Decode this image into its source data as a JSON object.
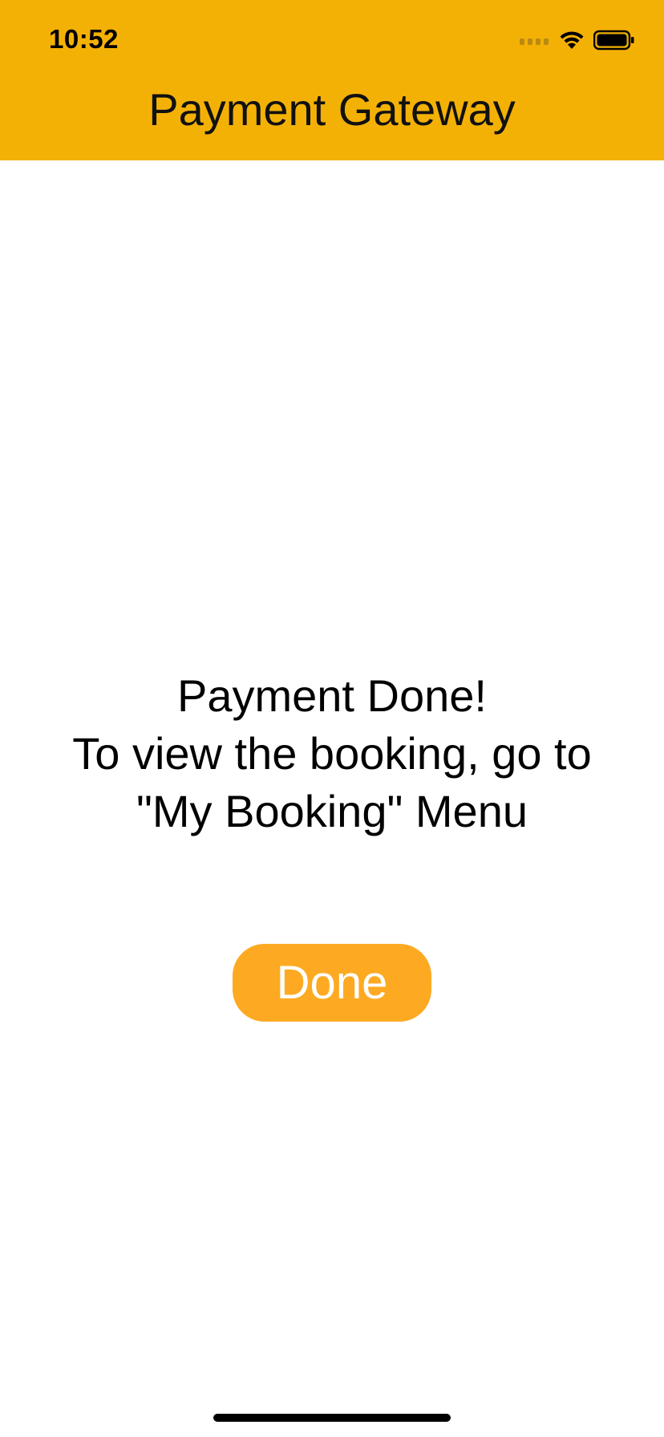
{
  "status_bar": {
    "time": "10:52",
    "icons": [
      "cellular-signal-icon",
      "wifi-icon",
      "battery-icon"
    ]
  },
  "nav": {
    "title": "Payment Gateway",
    "background_color": "#F4B105"
  },
  "message": {
    "line1": "Payment Done!",
    "line2": "To view the booking, go to",
    "line3": "\"My Booking\" Menu"
  },
  "done_button": {
    "label": "Done",
    "color": "#FDAA22"
  }
}
